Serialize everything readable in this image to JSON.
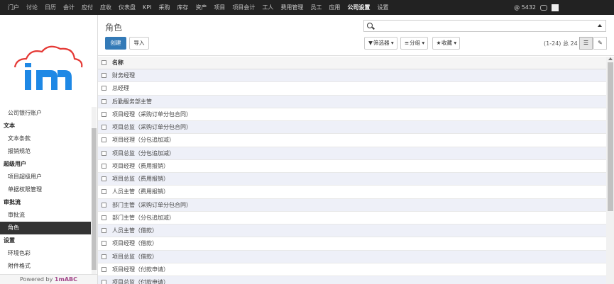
{
  "topnav": {
    "items": [
      "门户",
      "讨论",
      "日历",
      "会计",
      "应付",
      "应收",
      "仪表盘",
      "KPI",
      "采购",
      "库存",
      "资产",
      "项目",
      "项目会计",
      "工人",
      "费用管理",
      "员工",
      "应用",
      "公司设置",
      "设置"
    ],
    "active_index": 17
  },
  "topright": {
    "mail_count": "@ 5432"
  },
  "sidebar": {
    "items": [
      {
        "label": "公司银行账户",
        "type": "item"
      },
      {
        "label": "文本",
        "type": "header"
      },
      {
        "label": "文本条款",
        "type": "item"
      },
      {
        "label": "报销规范",
        "type": "item"
      },
      {
        "label": "超级用户",
        "type": "header"
      },
      {
        "label": "项目超级用户",
        "type": "item"
      },
      {
        "label": "单据权限管理",
        "type": "item"
      },
      {
        "label": "审批流",
        "type": "header"
      },
      {
        "label": "审批流",
        "type": "item"
      },
      {
        "label": "角色",
        "type": "active"
      },
      {
        "label": "设置",
        "type": "header"
      },
      {
        "label": "环境色彩",
        "type": "item"
      },
      {
        "label": "附件格式",
        "type": "item"
      }
    ],
    "powered_prefix": "Powered by ",
    "powered_brand": "1mABC"
  },
  "control": {
    "title": "角色",
    "create_label": "创建",
    "import_label": "导入",
    "search_value": "",
    "filter_label": "筛选器",
    "group_label": "分组",
    "fav_label": "收藏",
    "pager": "(1-24) 总 24"
  },
  "list": {
    "header": "名称",
    "rows": [
      "财务经理",
      "总经理",
      "后勤服务部主管",
      "项目经理（采购订单分包合同）",
      "项目总监（采购订单分包合同）",
      "项目经理（分包追加减）",
      "项目总监（分包追加减）",
      "项目经理（费用报销）",
      "项目总监（费用报销）",
      "人员主管（费用报销）",
      "部门主管（采购订单分包合同）",
      "部门主管（分包追加减）",
      "人员主管（借款）",
      "项目经理（借款）",
      "项目总监（借款）",
      "项目经理（付款申请）",
      "项目总监（付款申请）"
    ]
  },
  "colors": {
    "primary": "#337ab7",
    "topbar": "#222222",
    "brand": "#a24689",
    "logo_blue": "#1e88e5",
    "logo_red": "#e53935"
  }
}
